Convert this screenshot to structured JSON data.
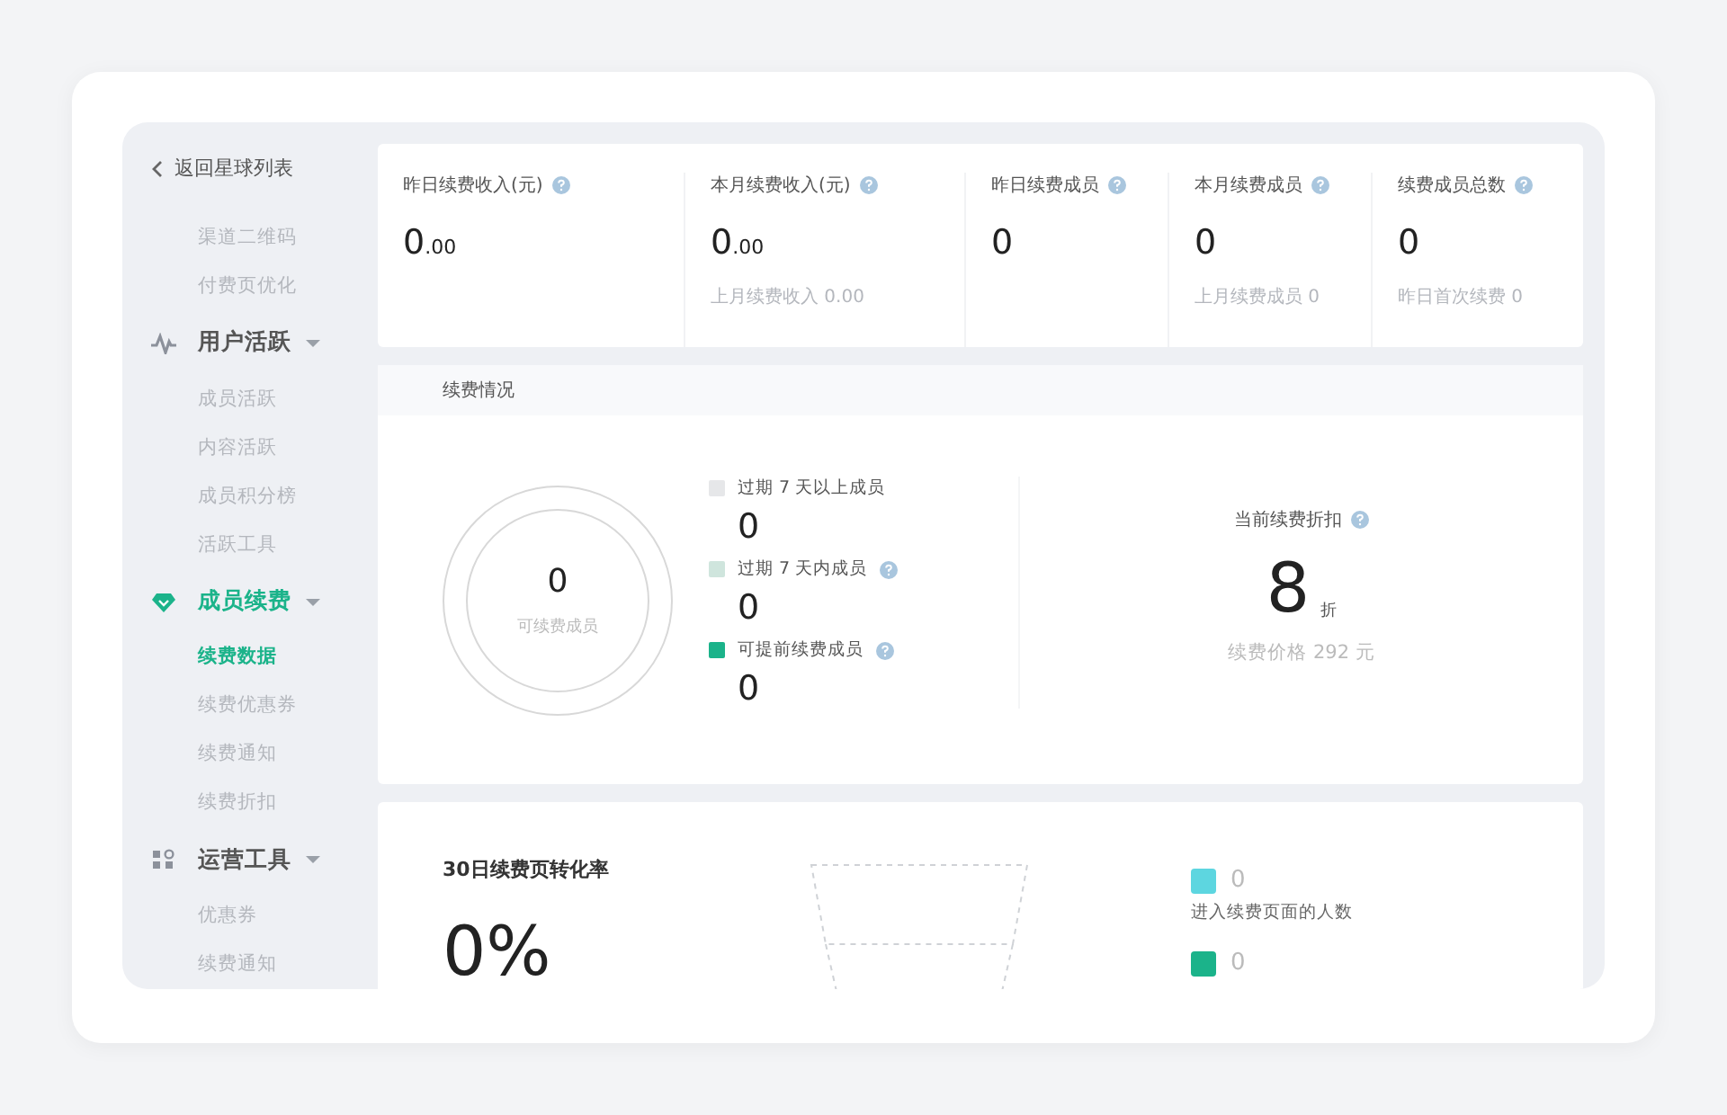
{
  "sidebar": {
    "back": "返回星球列表",
    "items": [
      {
        "kind": "item",
        "label": "渠道二维码",
        "selected": false
      },
      {
        "kind": "item",
        "label": "付费页优化",
        "selected": false
      },
      {
        "kind": "group",
        "label": "用户活跃",
        "selected": false,
        "expanded": true,
        "children": [
          {
            "label": "成员活跃",
            "selected": false
          },
          {
            "label": "内容活跃",
            "selected": false
          },
          {
            "label": "成员积分榜",
            "selected": false
          },
          {
            "label": "活跃工具",
            "selected": false
          }
        ]
      },
      {
        "kind": "group",
        "label": "成员续费",
        "selected": true,
        "expanded": true,
        "children": [
          {
            "label": "续费数据",
            "selected": true
          },
          {
            "label": "续费优惠券",
            "selected": false
          },
          {
            "label": "续费通知",
            "selected": false
          },
          {
            "label": "续费折扣",
            "selected": false
          }
        ]
      },
      {
        "kind": "group",
        "label": "运营工具",
        "selected": false,
        "expanded": true,
        "children": [
          {
            "label": "优惠券",
            "selected": false
          },
          {
            "label": "续费通知",
            "selected": false
          }
        ]
      }
    ]
  },
  "stats": [
    {
      "label": "昨日续费收入(元)",
      "value": "0",
      "fraction": ".00"
    },
    {
      "label": "本月续费收入(元)",
      "value": "0",
      "fraction": ".00",
      "sub": "上月续费收入 0.00"
    },
    {
      "label": "昨日续费成员",
      "value": "0"
    },
    {
      "label": "本月续费成员",
      "value": "0",
      "sub": "上月续费成员 0"
    },
    {
      "label": "续费成员总数",
      "value": "0",
      "sub": "昨日首次续费 0"
    }
  ],
  "renewal": {
    "title": "续费情况",
    "donut": {
      "value": "0",
      "label": "可续费成员"
    },
    "legend": [
      {
        "label": "过期 7 天以上成员",
        "value": "0",
        "color": "#e6e7e9",
        "help": false
      },
      {
        "label": "过期 7 天内成员",
        "value": "0",
        "color": "#cfe5dd",
        "help": true
      },
      {
        "label": "可提前续费成员",
        "value": "0",
        "color": "#1bb38a",
        "help": true
      }
    ],
    "discount": {
      "label": "当前续费折扣",
      "value": "8",
      "unit": "折",
      "price": "续费价格 292 元"
    }
  },
  "conversion": {
    "title": "30日续费页转化率",
    "rate": "0%",
    "legend": [
      {
        "value": "0",
        "label": "进入续费页面的人数",
        "color": "#5dd6e0"
      },
      {
        "value": "0",
        "color": "#1bb38a"
      }
    ]
  }
}
